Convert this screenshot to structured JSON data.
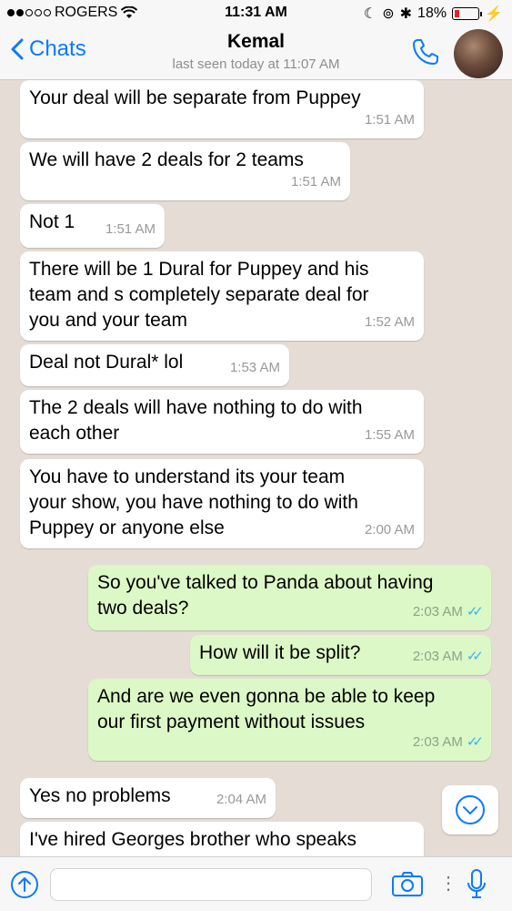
{
  "status_bar": {
    "carrier": "ROGERS",
    "time": "11:31 AM",
    "battery": "18%"
  },
  "header": {
    "back_label": "Chats",
    "contact_name": "Kemal",
    "last_seen": "last seen today at 11:07 AM"
  },
  "messages": [
    {
      "text": "Your deal will be separate from Puppey",
      "time": "1:51 AM"
    },
    {
      "text": "We will have 2 deals for 2 teams",
      "time": "1:51 AM"
    },
    {
      "text": "Not 1",
      "time": "1:51 AM"
    },
    {
      "text": "There will be 1 Dural for Puppey and his\nteam and s completely separate deal for\nyou and your team",
      "time": "1:52 AM"
    },
    {
      "text": "Deal not Dural* lol",
      "time": "1:53 AM"
    },
    {
      "text": "The 2 deals will have nothing to do with\neach other",
      "time": "1:55 AM"
    },
    {
      "text": "You have to understand its your team\nyour show, you have nothing to do with\nPuppey or anyone else",
      "time": "2:00 AM"
    },
    {
      "text": "So you've talked to Panda about having\ntwo deals?",
      "time": "2:03 AM"
    },
    {
      "text": "How will it be split?",
      "time": "2:03 AM"
    },
    {
      "text": "And are we even gonna be able to keep\nour first payment without issues",
      "time": "2:03 AM"
    },
    {
      "text": "Yes no problems",
      "time": "2:04 AM"
    },
    {
      "text": "I've hired Georges brother who speaks",
      "time": ""
    }
  ],
  "input": {
    "placeholder": ""
  },
  "icons": {
    "back": "chevron-left-icon",
    "call": "phone-icon",
    "scroll": "chevron-down-icon",
    "attach": "arrow-up-icon",
    "camera": "camera-icon",
    "mic": "microphone-icon"
  },
  "colors": {
    "accent": "#0a7aff",
    "incoming_bubble": "#ffffff",
    "outgoing_bubble": "#dcf8c6",
    "read_ticks": "#34b7f1",
    "chat_background": "#e5ddd5"
  }
}
